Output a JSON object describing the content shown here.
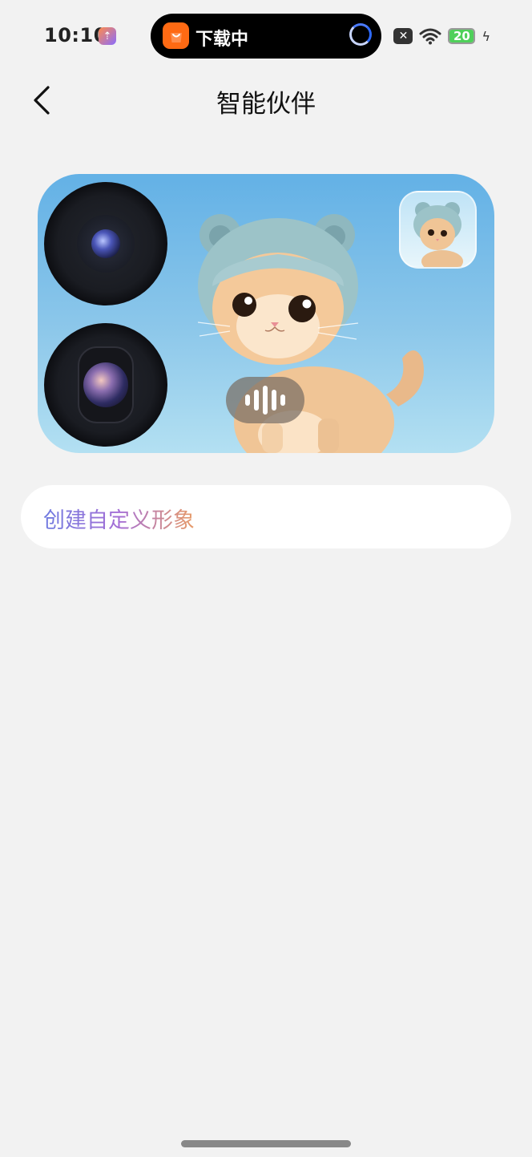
{
  "status_bar": {
    "time": "10:10",
    "battery_level": "20",
    "icons": [
      "app-update-icon",
      "close-badge-icon",
      "wifi-icon",
      "battery-icon",
      "charging-icon"
    ]
  },
  "dynamic_island": {
    "app_icon": "store-bag-icon",
    "label": "下载中",
    "progress_icon": "loading-spinner-icon"
  },
  "header": {
    "back_icon": "chevron-left-icon",
    "title": "智能伙伴"
  },
  "hero": {
    "icons": [
      "front-camera-lens-icon",
      "rear-camera-lens-icon",
      "cat-avatar-thumbnail",
      "voice-waveform-icon"
    ],
    "colors": {
      "sky_top": "#63b1e6",
      "sky_bottom": "#b3e0f2"
    }
  },
  "create": {
    "label": "创建自定义形象",
    "colors": {
      "gradient_start": "#6f7be0",
      "gradient_mid": "#a56fd6",
      "gradient_end": "#e89b66"
    }
  }
}
